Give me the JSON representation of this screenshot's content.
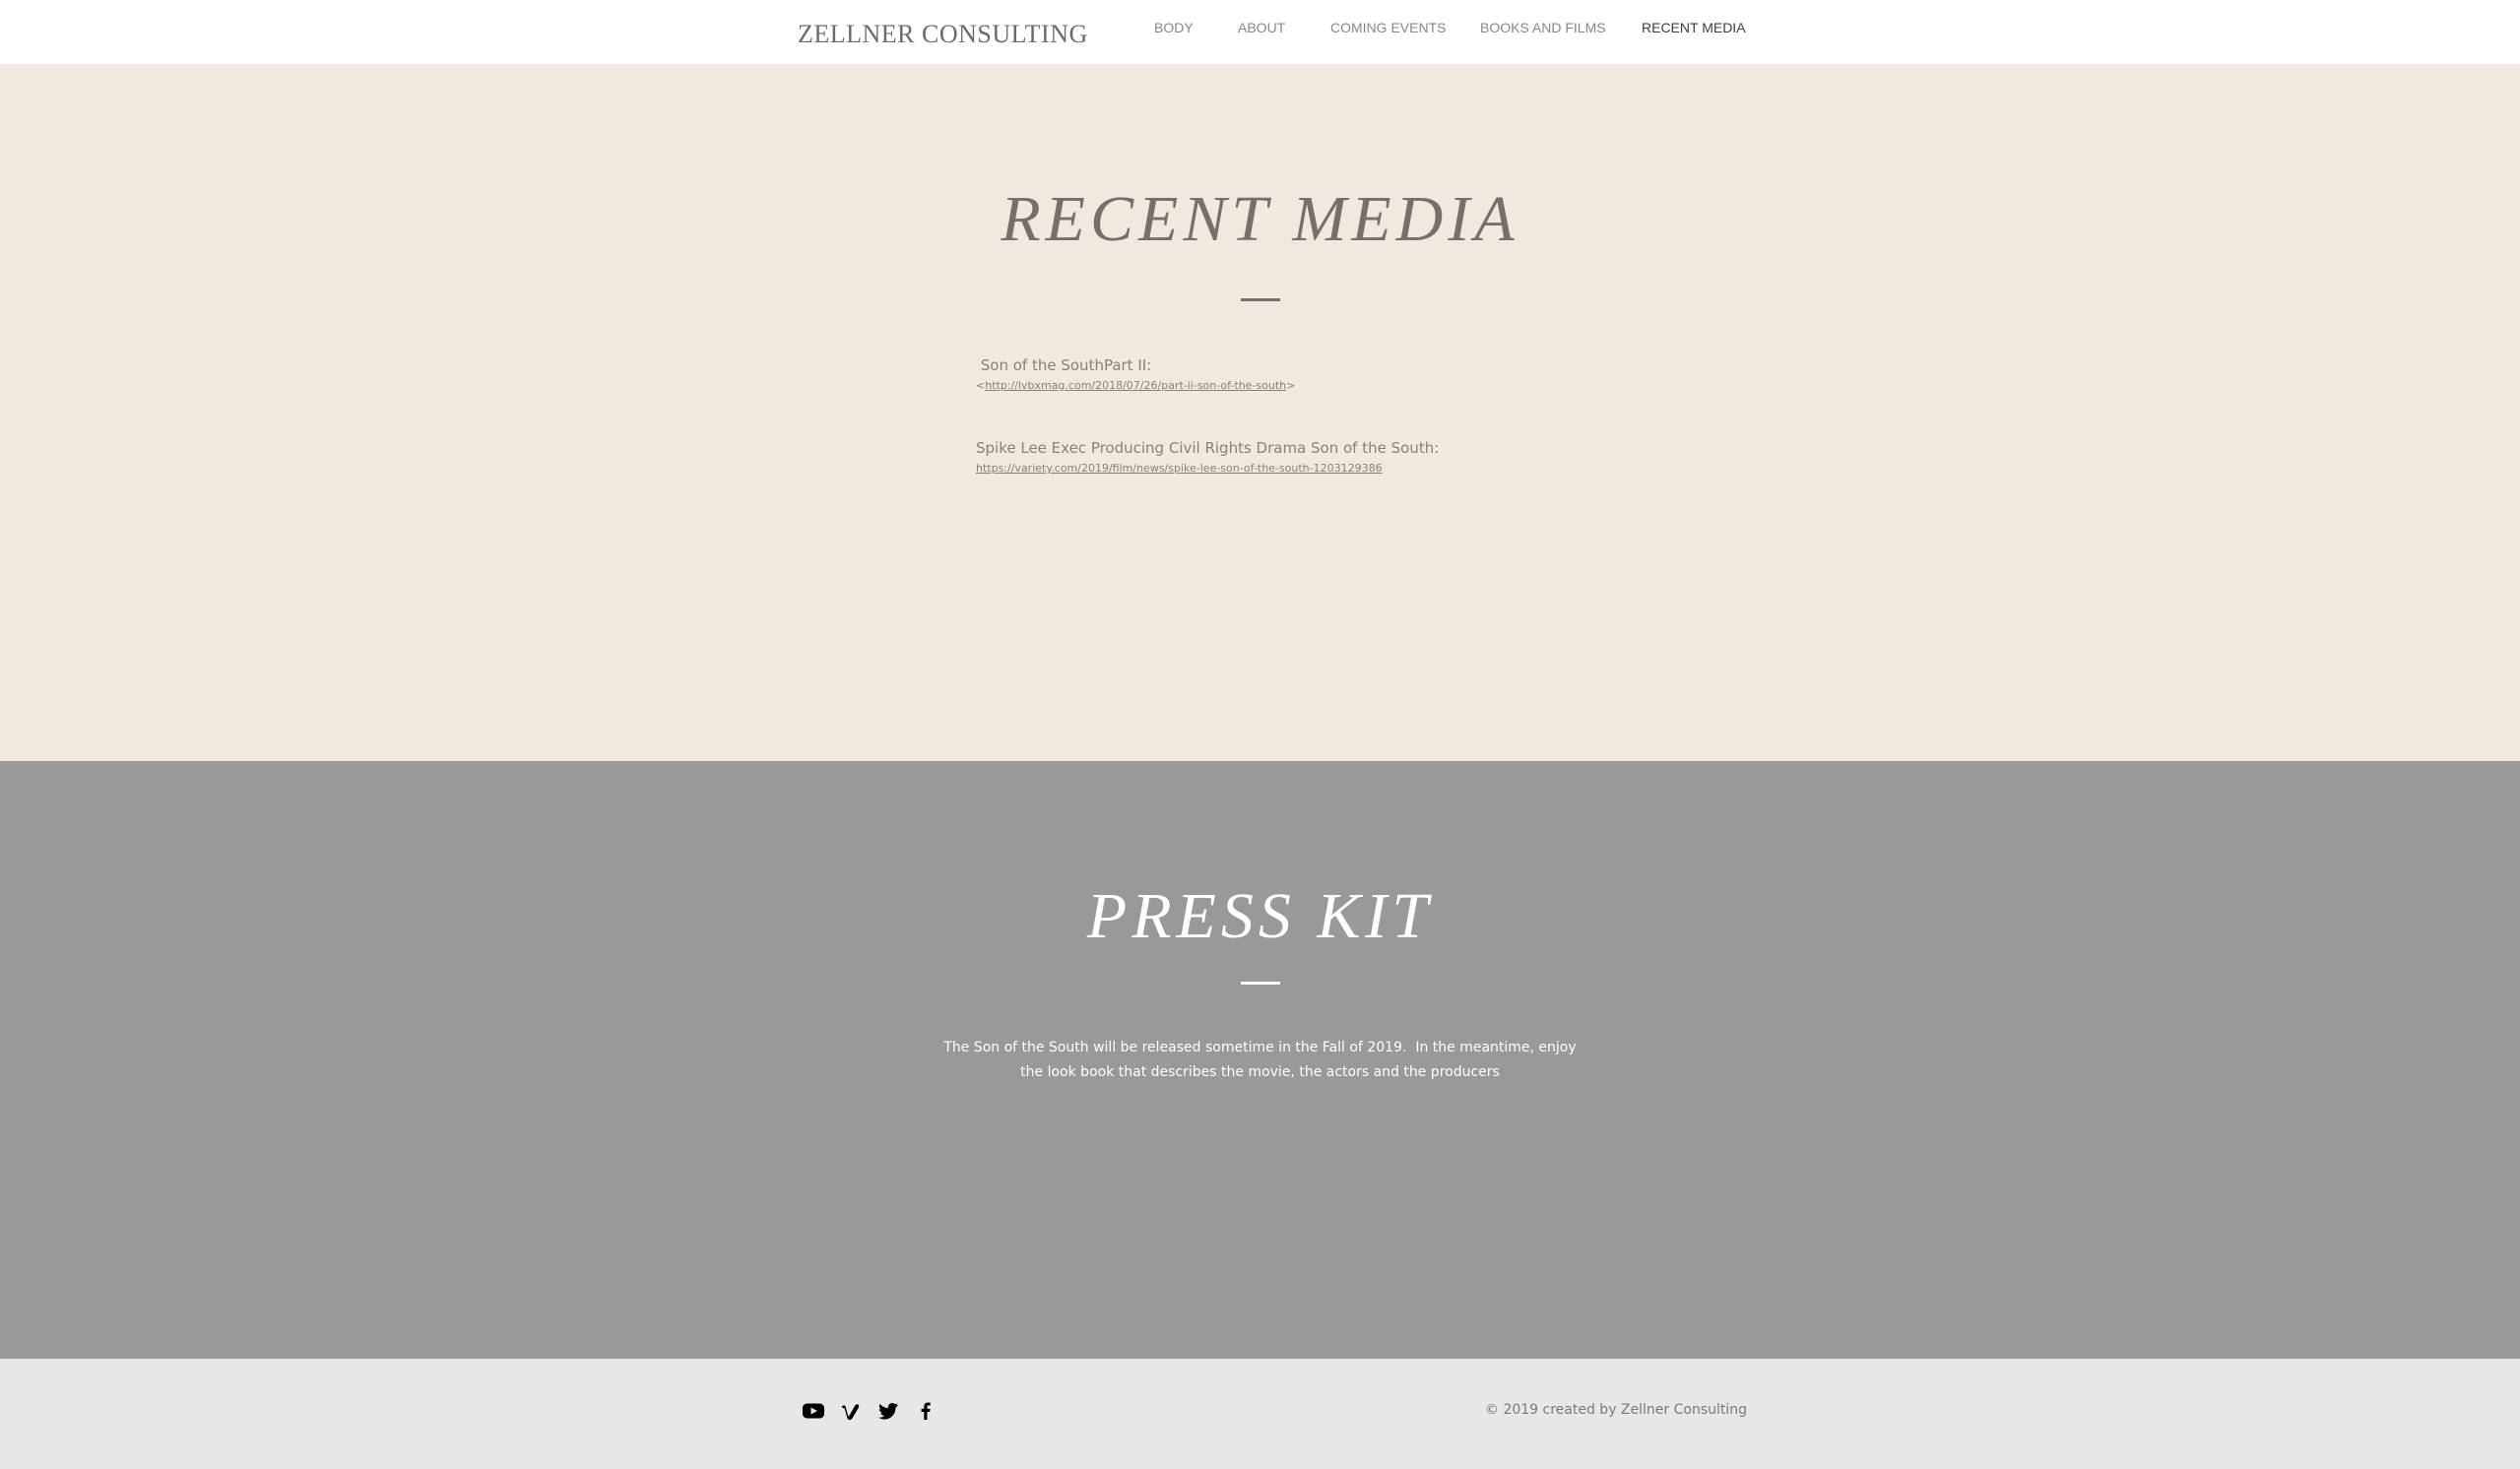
{
  "header": {
    "brand": "ZELLNER CONSULTING",
    "nav": [
      {
        "label": "BODY"
      },
      {
        "label": "ABOUT"
      },
      {
        "label": "COMING EVENTS"
      },
      {
        "label": "BOOKS AND FILMS"
      },
      {
        "label": "RECENT MEDIA",
        "active": true
      }
    ]
  },
  "recent_media": {
    "title": "RECENT MEDIA",
    "entries": [
      {
        "title": " Son of the SouthPart II:",
        "link_prefix": "<",
        "link": "http://lvbxmag.com/2018/07/26/part-ii-son-of-the-south",
        "link_suffix": ">"
      },
      {
        "title": "Spike Lee Exec Producing Civil Rights Drama Son of the South:",
        "link_prefix": "",
        "link": "https://variety.com/2019/film/news/spike-lee-son-of-the-south-1203129386",
        "link_suffix": ""
      }
    ]
  },
  "press_kit": {
    "title": "PRESS KIT",
    "text_line1": "The Son of the South will be released sometime in the Fall of 2019.  In the meantime, enjoy",
    "text_line2": "the look book that describes the movie, the actors and the producers"
  },
  "footer": {
    "social": [
      "youtube-icon",
      "vimeo-icon",
      "twitter-icon",
      "facebook-icon"
    ],
    "copyright": "© 2019 created by Zellner Consulting"
  },
  "colors": {
    "recent_bg": "#f1e9de",
    "press_bg": "#999998",
    "footer_bg": "#e8e6e6",
    "title_brown": "#7a6f67"
  }
}
